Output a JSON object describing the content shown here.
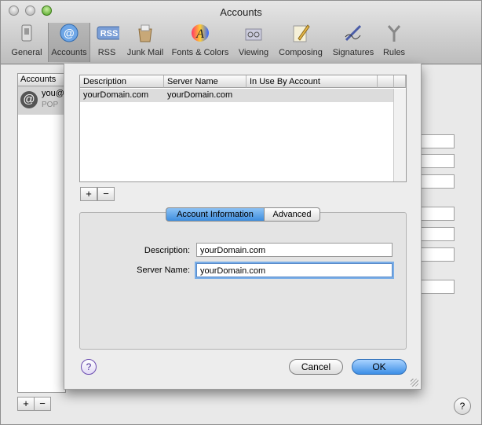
{
  "window": {
    "title": "Accounts"
  },
  "toolbar": {
    "items": [
      {
        "label": "General",
        "icon": "switch-icon"
      },
      {
        "label": "Accounts",
        "icon": "at-sign-icon"
      },
      {
        "label": "RSS",
        "icon": "rss-icon"
      },
      {
        "label": "Junk Mail",
        "icon": "junk-mail-icon"
      },
      {
        "label": "Fonts & Colors",
        "icon": "font-a-icon"
      },
      {
        "label": "Viewing",
        "icon": "glasses-icon"
      },
      {
        "label": "Composing",
        "icon": "pencil-paper-icon"
      },
      {
        "label": "Signatures",
        "icon": "pen-signature-icon"
      },
      {
        "label": "Rules",
        "icon": "rules-arrows-icon"
      }
    ],
    "selected": "Accounts"
  },
  "accounts_panel": {
    "header": "Accounts",
    "account_name": "you@",
    "account_type": "POP",
    "add_label": "+",
    "remove_label": "−",
    "help_label": "?"
  },
  "sheet": {
    "table": {
      "columns": [
        "Description",
        "Server Name",
        "In Use By Account"
      ],
      "rows": [
        {
          "description": "yourDomain.com",
          "server_name": "yourDomain.com",
          "in_use_by": ""
        }
      ]
    },
    "add_label": "+",
    "remove_label": "−",
    "tabs": {
      "active": "Account Information",
      "inactive": "Advanced"
    },
    "fields": {
      "description_label": "Description:",
      "description_value": "yourDomain.com",
      "server_name_label": "Server Name:",
      "server_name_value": "yourDomain.com"
    },
    "help_label": "?",
    "cancel_label": "Cancel",
    "ok_label": "OK"
  }
}
